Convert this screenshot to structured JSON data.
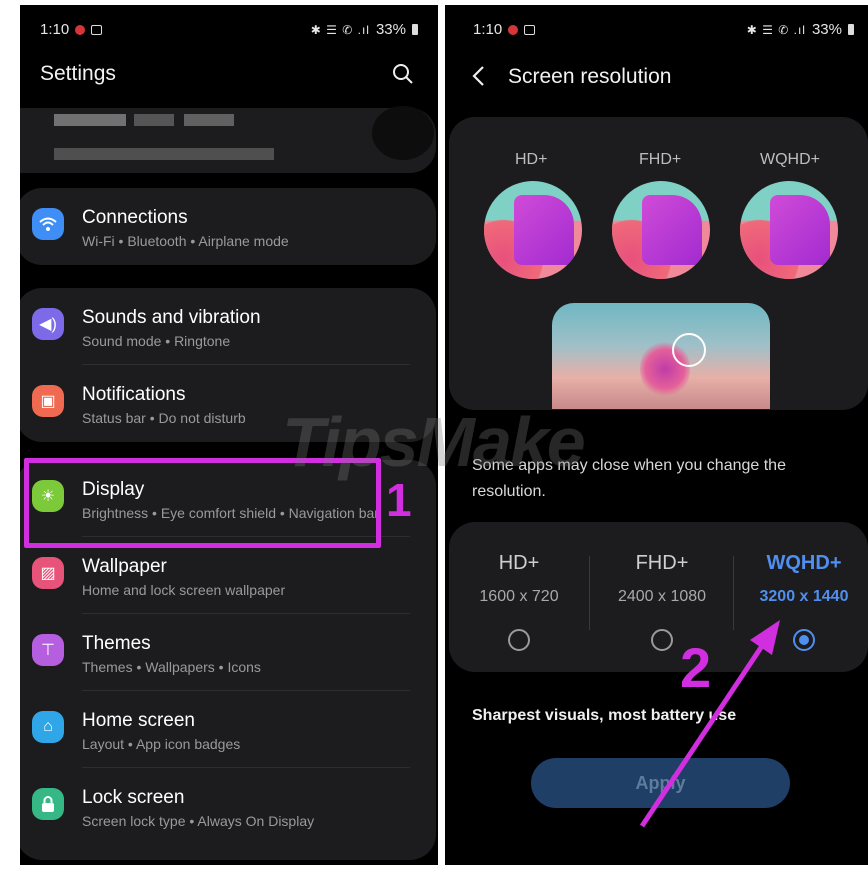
{
  "left": {
    "status": {
      "time": "1:10",
      "icons": "✱ ☰ ✆ .ıl",
      "battery": "33%"
    },
    "title": "Settings",
    "search_icon": "search-icon",
    "items": [
      {
        "title": "Connections",
        "sub": "Wi-Fi  •  Bluetooth  •  Airplane mode",
        "color": "#3f8ef5",
        "icon": "wifi-icon"
      },
      {
        "title": "Sounds and vibration",
        "sub": "Sound mode  •  Ringtone",
        "color": "#7d6ae8",
        "icon": "speaker-icon"
      },
      {
        "title": "Notifications",
        "sub": "Status bar  •  Do not disturb",
        "color": "#f06a52",
        "icon": "notification-icon"
      },
      {
        "title": "Display",
        "sub": "Brightness  •  Eye comfort shield  •  Navigation bar",
        "color": "#7cc93a",
        "icon": "sun-icon"
      },
      {
        "title": "Wallpaper",
        "sub": "Home and lock screen wallpaper",
        "color": "#e8537a",
        "icon": "image-icon"
      },
      {
        "title": "Themes",
        "sub": "Themes  •  Wallpapers  •  Icons",
        "color": "#b55ee0",
        "icon": "brush-icon"
      },
      {
        "title": "Home screen",
        "sub": "Layout  •  App icon badges",
        "color": "#2fa6e8",
        "icon": "home-icon"
      },
      {
        "title": "Lock screen",
        "sub": "Screen lock type  •  Always On Display",
        "color": "#36b886",
        "icon": "lock-icon"
      }
    ],
    "annotation": "1"
  },
  "right": {
    "status": {
      "time": "1:10",
      "icons": "✱ ☰ ✆ .ıl",
      "battery": "33%"
    },
    "title": "Screen resolution",
    "preview_labels": [
      "HD+",
      "FHD+",
      "WQHD+"
    ],
    "message": "Some apps may close when you change the resolution.",
    "options": [
      {
        "name": "HD+",
        "res": "1600 x 720",
        "selected": false
      },
      {
        "name": "FHD+",
        "res": "2400 x 1080",
        "selected": false
      },
      {
        "name": "WQHD+",
        "res": "3200 x 1440",
        "selected": true
      }
    ],
    "note": "Sharpest visuals, most battery use",
    "apply": "Apply",
    "annotation": "2"
  },
  "watermark": "TipsMake",
  "colors": {
    "accent": "#4f8ff0",
    "annotation": "#d12ee0",
    "card": "#1c1c1e"
  }
}
